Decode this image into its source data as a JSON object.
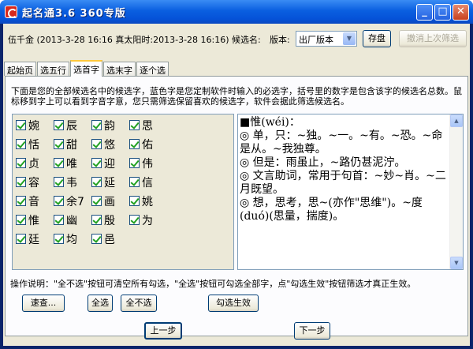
{
  "window": {
    "title": "起名通3.6 360专版",
    "minimize_label": "_",
    "maximize_label": "□",
    "close_label": "✕"
  },
  "topbar": {
    "info": "伍千金 (2013-3-28 16:16 真太阳时:2013-3-28 16:16) 候选名:",
    "version_label": "版本:",
    "version_value": "出厂版本",
    "save_label": "存盘",
    "undo_label": "撤消上次筛选"
  },
  "tabs": [
    "起始页",
    "选五行",
    "选首字",
    "选末字",
    "逐个选"
  ],
  "active_tab": "选首字",
  "description": "下面是您的全部候选名中的候选字，蓝色字是您定制软件时输入的必选字，括号里的数字是包含该字的候选名总数。鼠标移到字上可以看到字音字意，您只需筛选保留喜欢的候选字，软件会据此筛选候选名。",
  "characters": [
    [
      "婉",
      "辰",
      "韵",
      "思"
    ],
    [
      "恬",
      "甜",
      "悠",
      "佑"
    ],
    [
      "贞",
      "唯",
      "迎",
      "伟"
    ],
    [
      "容",
      "韦",
      "延",
      "信"
    ],
    [
      "音",
      "余7",
      "画",
      "姚"
    ],
    [
      "惟",
      "幽",
      "殷",
      "为"
    ],
    [
      "廷",
      "均",
      "邑",
      ""
    ]
  ],
  "definition": "■惟(wéi)：\n◎ 单，只：~独。~一。~有。~恐。~命是从。~我独尊。\n◎ 但是：雨虽止，~路仍甚泥泞。\n◎ 文言助词，常用于句首：~妙~肖。~二月既望。\n◎ 想，思考，思~(亦作\"思维\")。~度(duó)(思量，揣度)。",
  "help_text": "操作说明：\"全不选\"按钮可清空所有勾选，\"全选\"按钮可勾选全部字，点\"勾选生效\"按钮筛选才真正生效。",
  "buttons": {
    "quick_check": "速查...",
    "select_all": "全选",
    "select_none": "全不选",
    "apply": "勾选生效",
    "prev": "上一步",
    "next": "下一步"
  },
  "colors": {
    "title_bar": "#0a5fe0",
    "frame": "#0a246a",
    "dialog_bg": "#ece9d8",
    "tab_highlight": "#ffc83c"
  }
}
